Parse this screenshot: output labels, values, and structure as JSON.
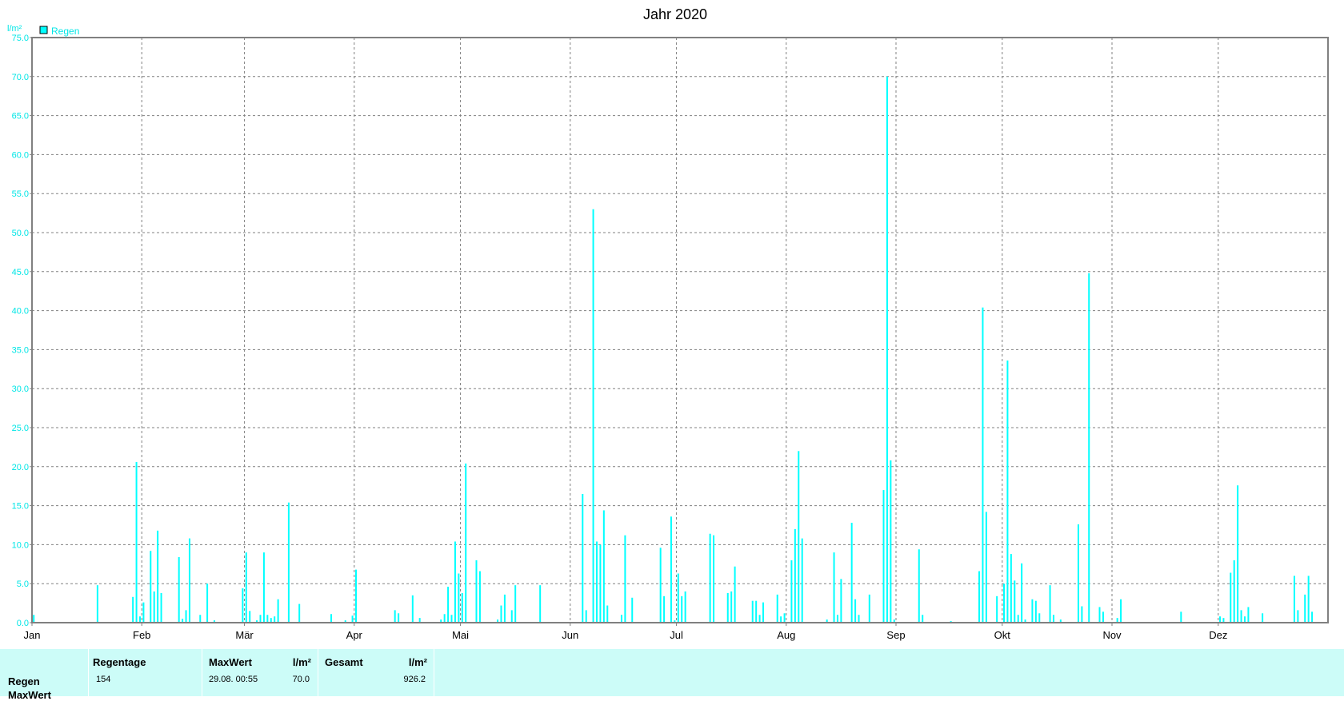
{
  "chart_data": {
    "type": "bar",
    "title": "Jahr 2020",
    "ylabel": "l/m²",
    "xlabel": "",
    "ylim": [
      0,
      75
    ],
    "yticks": [
      "0.0",
      "5.0",
      "10.0",
      "15.0",
      "20.0",
      "25.0",
      "30.0",
      "35.0",
      "40.0",
      "45.0",
      "50.0",
      "55.0",
      "60.0",
      "65.0",
      "70.0",
      "75.0"
    ],
    "x_axis": "day of year 2020",
    "month_labels": [
      "Jan",
      "Feb",
      "Mär",
      "Apr",
      "Mai",
      "Jun",
      "Jul",
      "Aug",
      "Sep",
      "Okt",
      "Nov",
      "Dez"
    ],
    "grid": true,
    "legend": "top-left",
    "series": [
      {
        "name": "Regen",
        "color": "#00ffff",
        "points": [
          [
            "01.01.",
            1.0
          ],
          [
            "19.01.",
            4.8
          ],
          [
            "29.01.",
            3.3
          ],
          [
            "30.01.",
            20.6
          ],
          [
            "31.01.",
            0.8
          ],
          [
            "01.02.",
            2.6
          ],
          [
            "03.02.",
            9.2
          ],
          [
            "04.02.",
            4.0
          ],
          [
            "05.02.",
            11.8
          ],
          [
            "06.02.",
            3.8
          ],
          [
            "11.02.",
            8.4
          ],
          [
            "12.02.",
            0.5
          ],
          [
            "13.02.",
            1.6
          ],
          [
            "14.02.",
            10.8
          ],
          [
            "17.02.",
            1.0
          ],
          [
            "19.02.",
            5.0
          ],
          [
            "21.02.",
            0.3
          ],
          [
            "29.02.",
            4.4
          ],
          [
            "01.03.",
            9.0
          ],
          [
            "02.03.",
            1.5
          ],
          [
            "04.03.",
            0.3
          ],
          [
            "05.03.",
            1.0
          ],
          [
            "06.03.",
            9.0
          ],
          [
            "07.03.",
            1.0
          ],
          [
            "08.03.",
            0.6
          ],
          [
            "09.03.",
            0.8
          ],
          [
            "10.03.",
            3.0
          ],
          [
            "13.03.",
            15.4
          ],
          [
            "16.03.",
            2.4
          ],
          [
            "25.03.",
            1.1
          ],
          [
            "29.03.",
            0.3
          ],
          [
            "31.03.",
            0.9
          ],
          [
            "01.04.",
            6.8
          ],
          [
            "12.04.",
            1.6
          ],
          [
            "13.04.",
            1.2
          ],
          [
            "17.04.",
            3.5
          ],
          [
            "19.04.",
            0.6
          ],
          [
            "25.04.",
            0.4
          ],
          [
            "26.04.",
            1.1
          ],
          [
            "27.04.",
            4.6
          ],
          [
            "28.04.",
            1.0
          ],
          [
            "29.04.",
            10.4
          ],
          [
            "30.04.",
            6.3
          ],
          [
            "01.05.",
            3.8
          ],
          [
            "02.05.",
            20.4
          ],
          [
            "05.05.",
            8.0
          ],
          [
            "06.05.",
            6.6
          ],
          [
            "11.05.",
            0.4
          ],
          [
            "12.05.",
            2.2
          ],
          [
            "13.05.",
            3.6
          ],
          [
            "15.05.",
            1.6
          ],
          [
            "16.05.",
            4.8
          ],
          [
            "23.05.",
            4.8
          ],
          [
            "04.06.",
            16.5
          ],
          [
            "05.06.",
            1.6
          ],
          [
            "07.06.",
            53.0
          ],
          [
            "08.06.",
            10.4
          ],
          [
            "09.06.",
            10.0
          ],
          [
            "10.06.",
            14.4
          ],
          [
            "11.06.",
            2.2
          ],
          [
            "14.06.",
            0.1
          ],
          [
            "15.06.",
            1.0
          ],
          [
            "16.06.",
            11.2
          ],
          [
            "18.06.",
            3.2
          ],
          [
            "26.06.",
            9.6
          ],
          [
            "27.06.",
            3.4
          ],
          [
            "29.06.",
            13.6
          ],
          [
            "30.06.",
            0.3
          ],
          [
            "01.07.",
            6.3
          ],
          [
            "02.07.",
            3.4
          ],
          [
            "03.07.",
            4.0
          ],
          [
            "10.07.",
            11.4
          ],
          [
            "11.07.",
            11.2
          ],
          [
            "15.07.",
            3.8
          ],
          [
            "16.07.",
            4.0
          ],
          [
            "17.07.",
            7.2
          ],
          [
            "22.07.",
            2.8
          ],
          [
            "23.07.",
            2.8
          ],
          [
            "24.07.",
            1.0
          ],
          [
            "25.07.",
            2.6
          ],
          [
            "29.07.",
            3.6
          ],
          [
            "30.07.",
            0.8
          ],
          [
            "31.07.",
            1.2
          ],
          [
            "02.08.",
            8.0
          ],
          [
            "03.08.",
            12.0
          ],
          [
            "04.08.",
            22.0
          ],
          [
            "05.08.",
            10.8
          ],
          [
            "12.08.",
            0.4
          ],
          [
            "14.08.",
            9.0
          ],
          [
            "15.08.",
            1.0
          ],
          [
            "16.08.",
            5.6
          ],
          [
            "19.08.",
            12.8
          ],
          [
            "20.08.",
            3.0
          ],
          [
            "21.08.",
            1.0
          ],
          [
            "24.08.",
            3.6
          ],
          [
            "28.08.",
            17.0
          ],
          [
            "29.08.",
            70.0
          ],
          [
            "30.08.",
            20.8
          ],
          [
            "31.08.",
            0.4
          ],
          [
            "07.09.",
            9.4
          ],
          [
            "08.09.",
            1.0
          ],
          [
            "16.09.",
            0.2
          ],
          [
            "24.09.",
            6.6
          ],
          [
            "25.09.",
            40.4
          ],
          [
            "26.09.",
            14.2
          ],
          [
            "29.09.",
            3.4
          ],
          [
            "01.10.",
            5.0
          ],
          [
            "02.10.",
            33.6
          ],
          [
            "03.10.",
            8.8
          ],
          [
            "04.10.",
            5.4
          ],
          [
            "05.10.",
            1.0
          ],
          [
            "06.10.",
            7.6
          ],
          [
            "07.10.",
            0.4
          ],
          [
            "09.10.",
            3.0
          ],
          [
            "10.10.",
            2.8
          ],
          [
            "11.10.",
            1.2
          ],
          [
            "14.10.",
            4.8
          ],
          [
            "15.10.",
            1.0
          ],
          [
            "17.10.",
            0.4
          ],
          [
            "22.10.",
            12.6
          ],
          [
            "23.10.",
            2.1
          ],
          [
            "25.10.",
            44.8
          ],
          [
            "28.10.",
            2.0
          ],
          [
            "29.10.",
            1.4
          ],
          [
            "02.11.",
            0.6
          ],
          [
            "03.11.",
            3.0
          ],
          [
            "20.11.",
            1.4
          ],
          [
            "01.12.",
            0.8
          ],
          [
            "02.12.",
            0.6
          ],
          [
            "04.12.",
            6.4
          ],
          [
            "05.12.",
            8.0
          ],
          [
            "06.12.",
            17.6
          ],
          [
            "07.12.",
            1.6
          ],
          [
            "08.12.",
            0.8
          ],
          [
            "09.12.",
            2.0
          ],
          [
            "13.12.",
            1.2
          ],
          [
            "22.12.",
            6.0
          ],
          [
            "23.12.",
            1.6
          ],
          [
            "25.12.",
            3.6
          ],
          [
            "26.12.",
            6.0
          ],
          [
            "27.12.",
            1.4
          ]
        ]
      }
    ]
  },
  "stats": {
    "row_labels": [
      "Regen",
      "MaxWert"
    ],
    "regentage": {
      "header": "Regentage",
      "value": "154"
    },
    "maxwert": {
      "header": "MaxWert",
      "unit": "l/m²",
      "date": "29.08.  00:55",
      "value": "70.0"
    },
    "gesamt": {
      "header": "Gesamt",
      "unit": "l/m²",
      "value": "926.2"
    }
  }
}
